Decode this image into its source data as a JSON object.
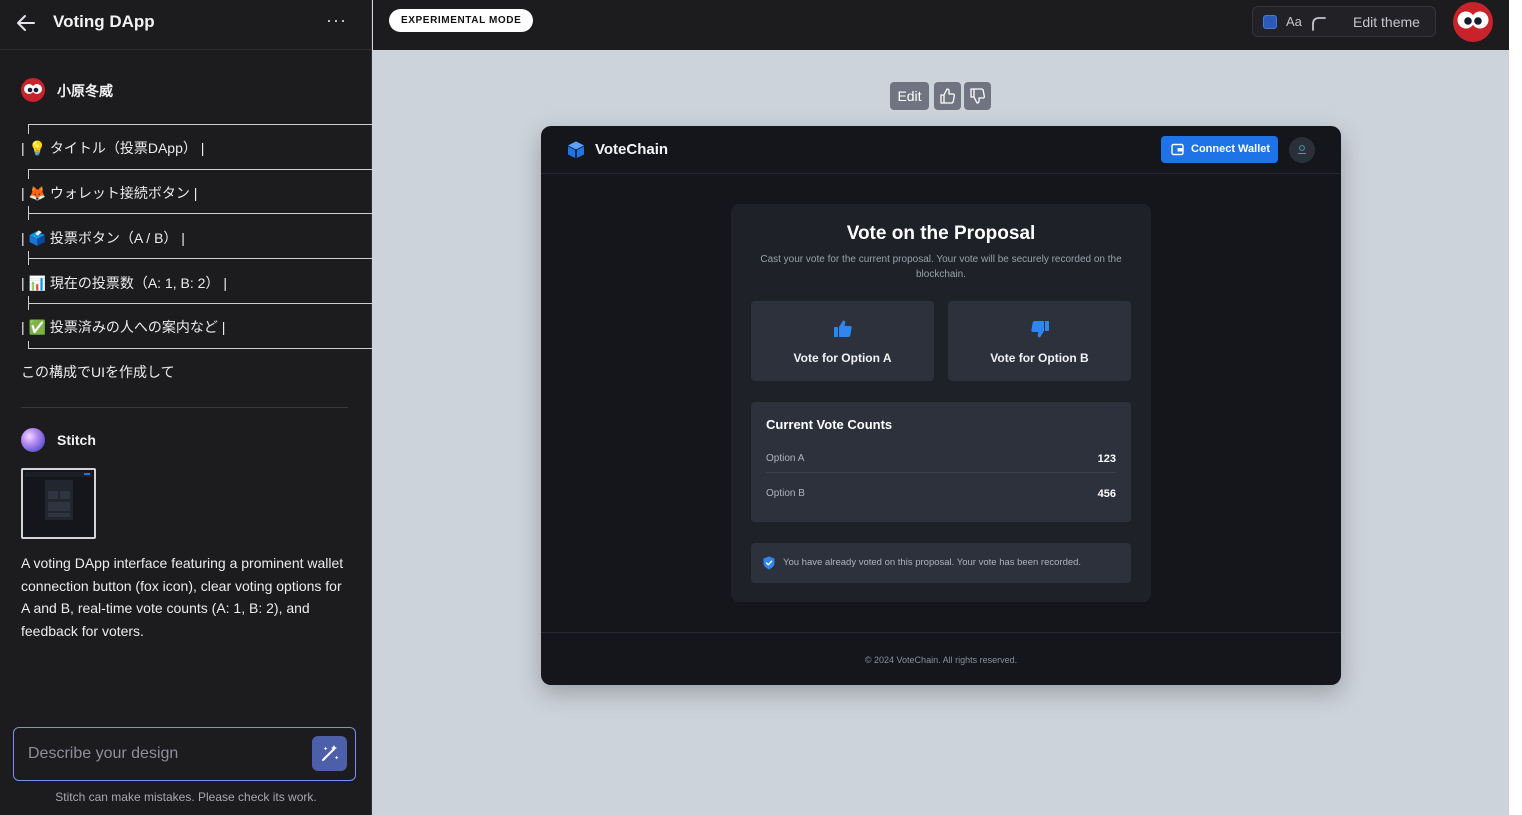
{
  "sidebar": {
    "title": "Voting DApp",
    "more_label": "···",
    "user_name": "小原冬威",
    "tree_items": [
      "| 💡 タイトル（投票DApp） |",
      "| 🦊 ウォレット接続ボタン |",
      "| 🗳️ 投票ボタン（A / B） |",
      "| 📊 現在の投票数（A: 1, B: 2） |",
      "| ✅ 投票済みの人への案内など |"
    ],
    "user_message": "この構成でUIを作成して",
    "assistant_name": "Stitch",
    "assistant_message": "A voting DApp interface featuring a prominent wallet connection button (fox icon), clear voting options for A and B, real-time vote counts (A: 1, B: 2), and feedback for voters.",
    "prompt_placeholder": "Describe your design",
    "disclaimer": "Stitch can make mistakes. Please check its work."
  },
  "topbar": {
    "badge": "EXPERIMENTAL MODE",
    "font_label": "Aa",
    "edit_theme_label": "Edit theme",
    "theme_color": "#2a5bb8"
  },
  "canvas_toolbar": {
    "edit_label": "Edit"
  },
  "design": {
    "brand": "VoteChain",
    "connect_label": "Connect Wallet",
    "accent_color": "#1f73e8",
    "heading": "Vote on the Proposal",
    "subheading": "Cast your vote for the current proposal. Your vote will be securely recorded on the blockchain.",
    "vote_a_label": "Vote for Option A",
    "vote_b_label": "Vote for Option B",
    "counts_title": "Current Vote Counts",
    "counts": [
      {
        "label": "Option A",
        "value": "123"
      },
      {
        "label": "Option B",
        "value": "456"
      }
    ],
    "notice": "You have already voted on this proposal. Your vote has been recorded.",
    "footer": "© 2024 VoteChain. All rights reserved."
  }
}
